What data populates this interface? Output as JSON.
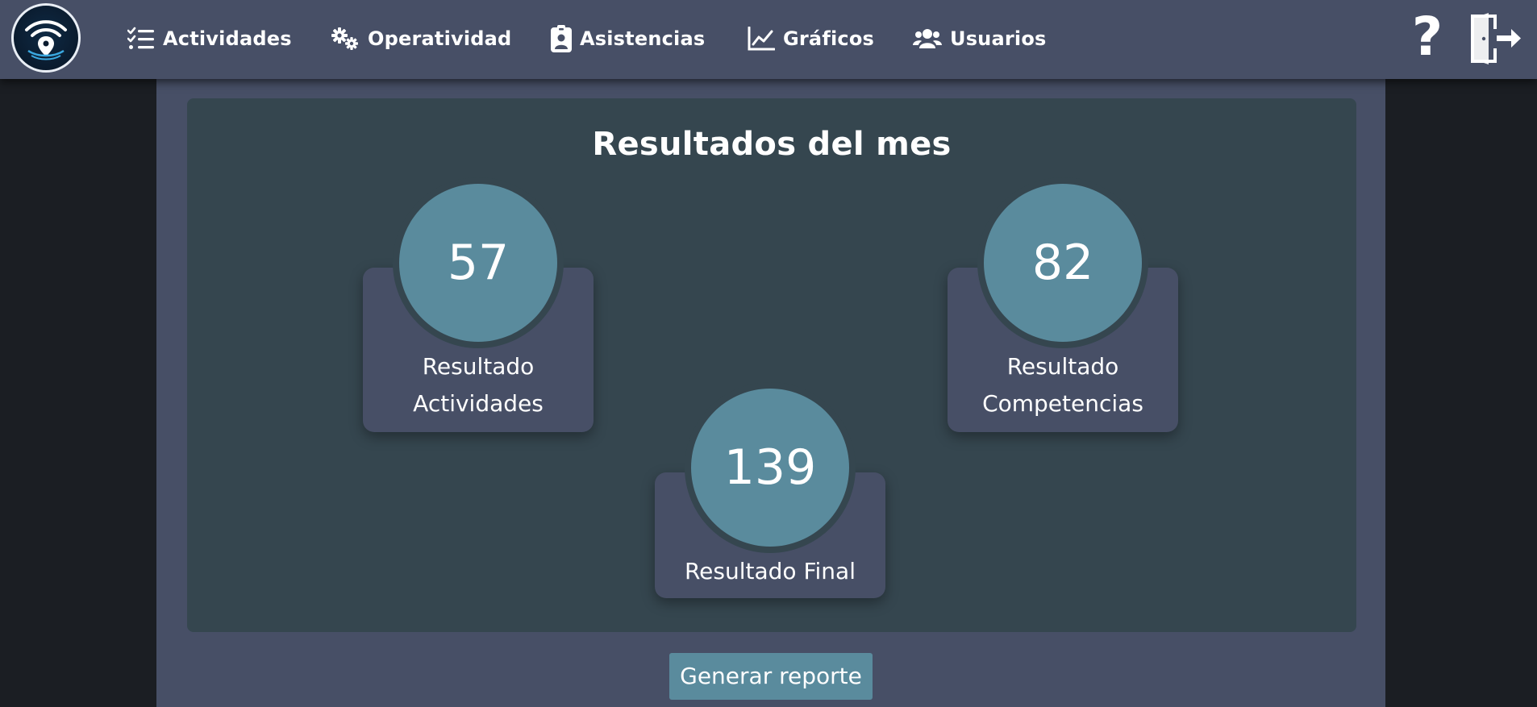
{
  "nav": {
    "items": [
      {
        "label": "Actividades",
        "icon": "checklist-icon"
      },
      {
        "label": "Operatividad",
        "icon": "gears-icon"
      },
      {
        "label": "Asistencias",
        "icon": "id-badge-icon"
      },
      {
        "label": "Gráficos",
        "icon": "line-chart-icon"
      },
      {
        "label": "Usuarios",
        "icon": "users-icon"
      }
    ],
    "help_glyph": "?"
  },
  "results": {
    "title": "Resultados del mes",
    "activities": {
      "value": "57",
      "label_line1": "Resultado",
      "label_line2": "Actividades"
    },
    "competencies": {
      "value": "82",
      "label_line1": "Resultado",
      "label_line2": "Competencias"
    },
    "final": {
      "value": "139",
      "label": "Resultado Final"
    }
  },
  "actions": {
    "report_label": "Generar reporte"
  },
  "colors": {
    "navbar": "#474f66",
    "panel": "#35464f",
    "accent": "#5a8b9d",
    "background": "#1b1e23"
  }
}
